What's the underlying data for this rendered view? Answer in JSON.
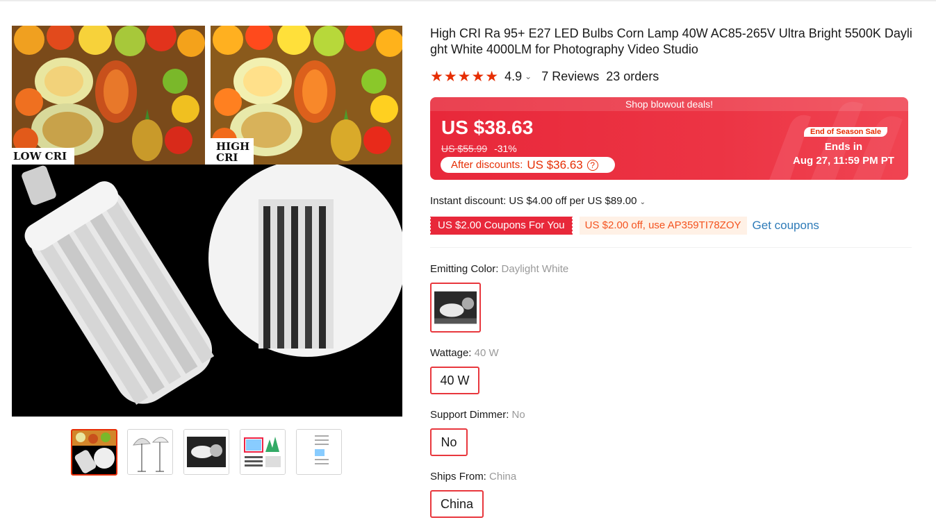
{
  "gallery": {
    "image_labels": {
      "low_cri": "LOW CRI",
      "high_cri_1": "HIGH",
      "high_cri_2": "CRI"
    }
  },
  "product": {
    "title": "High CRI Ra 95+ E27 LED Bulbs Corn Lamp 40W AC85-265V Ultra Bright 5500K Daylight White 4000LM for Photography Video Studio",
    "rating": {
      "stars": "★★★★★",
      "score": "4.9",
      "reviews": "7 Reviews",
      "orders": "23 orders"
    }
  },
  "price_box": {
    "banner": "Shop blowout deals!",
    "current_price": "US $38.63",
    "original_price": "US $55.99",
    "discount_pct": "-31%",
    "after_discount_label": "After discounts:",
    "after_discount_price": "US $36.63",
    "season_badge": "End of Season Sale",
    "ends_label": "Ends in",
    "ends_date": "Aug 27, 11:59 PM PT",
    "colors": {
      "primary": "#e8283a",
      "accent": "#e62e04"
    }
  },
  "discounts": {
    "instant": "Instant discount: US $4.00 off per US $89.00",
    "coupon_badge": "US $2.00 Coupons For You",
    "coupon_code": "US $2.00 off, use AP359TI78ZOY",
    "get_coupons": "Get coupons"
  },
  "sku": {
    "emitting_color": {
      "label": "Emitting Color:",
      "value": "Daylight White"
    },
    "wattage": {
      "label": "Wattage:",
      "value": "40 W",
      "option": "40 W"
    },
    "dimmer": {
      "label": "Support Dimmer:",
      "value": "No",
      "option": "No"
    },
    "ships_from": {
      "label": "Ships From:",
      "value": "China",
      "option": "China"
    }
  }
}
